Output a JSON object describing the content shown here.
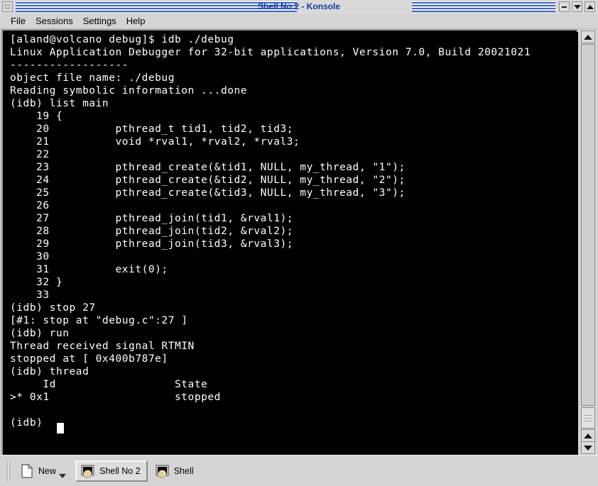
{
  "window": {
    "title": "Shell No 2 - Konsole",
    "title_color": "#123c9e",
    "window_menu_icon": "window-menu-icon",
    "buttons": [
      {
        "name": "minimize-button",
        "glyph": "minus"
      },
      {
        "name": "maximize-button",
        "glyph": "down-triangle"
      },
      {
        "name": "restore-button",
        "glyph": "up-triangle"
      }
    ]
  },
  "menubar": {
    "items": [
      {
        "label": "File"
      },
      {
        "label": "Sessions"
      },
      {
        "label": "Settings"
      },
      {
        "label": "Help"
      }
    ]
  },
  "terminal": {
    "background": "#000000",
    "foreground": "#ffffff",
    "prompt": "(idb)",
    "cursor_visible": true,
    "lines": [
      "[aland@volcano debug]$ idb ./debug",
      "Linux Application Debugger for 32-bit applications, Version 7.0, Build 20021021",
      "------------------",
      "object file name: ./debug",
      "Reading symbolic information ...done",
      "(idb) list main",
      "    19 {",
      "    20          pthread_t tid1, tid2, tid3;",
      "    21          void *rval1, *rval2, *rval3;",
      "    22",
      "    23          pthread_create(&tid1, NULL, my_thread, \"1\");",
      "    24          pthread_create(&tid2, NULL, my_thread, \"2\");",
      "    25          pthread_create(&tid3, NULL, my_thread, \"3\");",
      "    26",
      "    27          pthread_join(tid1, &rval1);",
      "    28          pthread_join(tid2, &rval2);",
      "    29          pthread_join(tid3, &rval3);",
      "    30",
      "    31          exit(0);",
      "    32 }",
      "    33",
      "(idb) stop 27",
      "[#1: stop at \"debug.c\":27 ]",
      "(idb) run",
      "Thread received signal RTMIN",
      "stopped at [ 0x400b787e]",
      "(idb) thread",
      "     Id                  State",
      ">* 0x1                   stopped",
      "",
      "(idb) "
    ]
  },
  "scrollbar": {
    "top_arrow": "scroll-up-icon",
    "bottom_up_arrow": "scroll-up-icon",
    "bottom_down_arrow": "scroll-down-icon",
    "grip": "resize-grip-icon"
  },
  "sessionbar": {
    "new_button": {
      "label": "New",
      "icon": "new-document-icon",
      "dropdown": "chevron-down-icon"
    },
    "sessions": [
      {
        "label": "Shell No 2",
        "icon": "konsole-shell-icon",
        "active": true
      },
      {
        "label": "Shell",
        "icon": "konsole-shell-icon",
        "active": false
      }
    ]
  }
}
